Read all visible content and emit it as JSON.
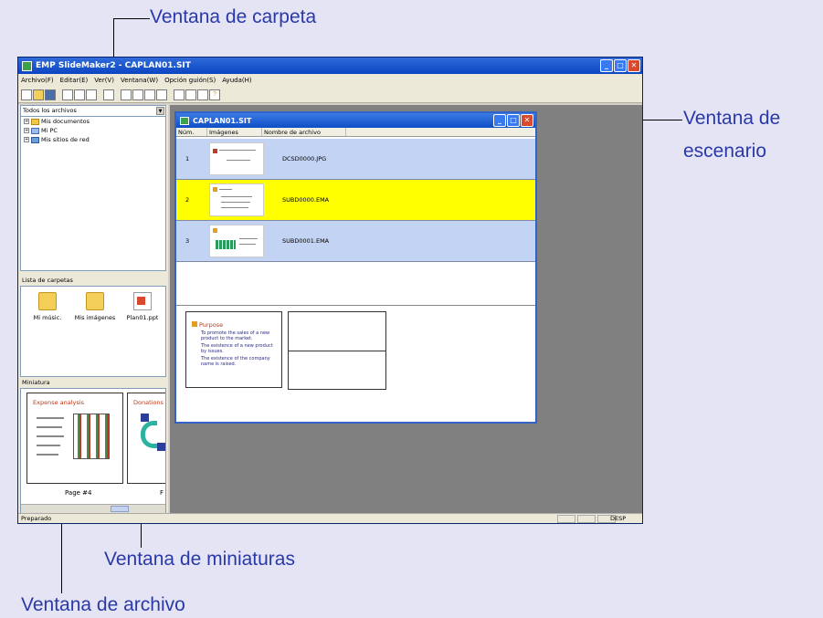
{
  "callouts": {
    "folder_window": "Ventana de carpeta",
    "scenario_window_line1": "Ventana de",
    "scenario_window_line2": "escenario",
    "thumbnail_window": "Ventana de miniaturas",
    "file_window": "Ventana de archivo"
  },
  "app": {
    "title": "EMP SlideMaker2 - CAPLAN01.SIT",
    "menu": [
      "Archivo(F)",
      "Editar(E)",
      "Ver(V)",
      "Ventana(W)",
      "Opción guión(S)",
      "Ayuda(H)"
    ],
    "status": "Preparado",
    "status_right": "DESP"
  },
  "folder_pane": {
    "combo_value": "Todos los archivos",
    "tree": [
      "Mis documentos",
      "Mi PC",
      "Mis sitios de red"
    ]
  },
  "file_pane": {
    "header": "Lista de carpetas",
    "items": [
      "Mi músic.",
      "Mis imágenes",
      "Plan01.ppt"
    ]
  },
  "thumb_pane": {
    "header": "Miniatura",
    "card1_title": "Expense analysis",
    "card2_title": "Donations",
    "card1_label": "Page #4",
    "card2_label": "F"
  },
  "scenario": {
    "title": "CAPLAN01.SIT",
    "columns": [
      "Núm.",
      "Imágenes",
      "Nombre de archivo"
    ],
    "rows": [
      {
        "num": "1",
        "name": "DCSD0000.JPG"
      },
      {
        "num": "2",
        "name": "SUBD0000.EMA"
      },
      {
        "num": "3",
        "name": "SUBD0001.EMA"
      }
    ],
    "preview_title": "Purpose",
    "preview_bullets": [
      "To promote the sales of a new product to the market.",
      "The existence of a new product by issues.",
      "The existence of the company name is raised."
    ]
  },
  "colors": {
    "callout_text": "#2a39a8",
    "row_blue": "#c3d3f3",
    "row_yellow": "#ffff00"
  }
}
